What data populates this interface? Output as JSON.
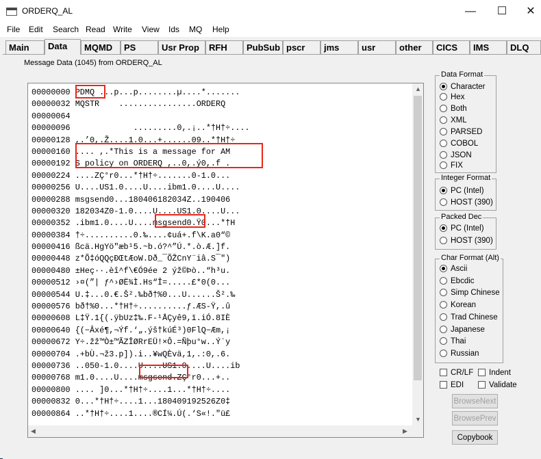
{
  "window": {
    "title": "ORDERQ_AL"
  },
  "menu": [
    "File",
    "Edit",
    "Search",
    "Read",
    "Write",
    "View",
    "Ids",
    "MQ",
    "Help"
  ],
  "tabs": [
    "Main",
    "Data",
    "MQMD",
    "PS",
    "Usr Prop",
    "RFH",
    "PubSub",
    "pscr",
    "jms",
    "usr",
    "other",
    "CICS",
    "IMS",
    "DLQ"
  ],
  "active_tab": "Data",
  "message_label": "Message Data (1045) from ORDERQ_AL",
  "data_lines": [
    "00000000 PDMQ ...p...p........µ....*.......",
    "00000032 MQSTR    ................ORDERQ",
    "00000064",
    "00000096             .........0,.¡..*†H†÷....",
    "00000128 ,.’0,.Ž....1.0...+......09..*†H†÷",
    "00000160 .... ,.*This is a message for AM",
    "00000192 S policy on ORDERQ ,..0,.ý0,.f .",
    "00000224 ....ZÇ°r0...*†H†÷.......0-1.0...",
    "00000256 U....US1.0....U....ibm1.0....U....",
    "00000288 msgsend0...180406182034Z..190406",
    "00000320 182034Z0-1.0....U....US1.0....U...",
    "00000352 .ibm1.0....U....msgsend0.Ÿ0...*†H",
    "00000384 †÷..........0.‰....¢uá+.f\\K.a0“©",
    "00000416 ßcä.HgYö\"æb¹5.~b.ó?^”Ú.*.ò.Æ.]f.",
    "00000448 z*Õ‡óQQçÐŒtÆoW.Dð_¯ÕŽCnY¨iâ.S¯\")",
    "00000480 ±Heç··.èî^f\\€Ó9ée 2 ýž©Þò..“h³u.",
    "00000512 ›¤(”| ƒ^›ØË¾Ì.Hs“Î=.....£*0(0...",
    "00000544 U.‡...0.€.Š².‰bð†%0...U......Š².‰",
    "00000576 bð†%0...*†H†÷..........ƒ.ÆS-Ÿ,.û",
    "00000608 L‡Ÿ.1{(.ÿbUz‡‰.F-¹ÅÇyê9,ï.iÓ.8IÈ",
    "00000640 {(−Âxé¶,¬Ýf.‘„.ýš†kúÉ³)0FlQ−Æm,¡",
    "00000672 Y÷.žž™Ò±™ÃZÎØRrEÜ!×Ô.=Ñþu°w..Ý`y",
    "00000704 .+bÙ.¬ž3.p]).i..¥wQÈvä,1,.:0,.6.",
    "00000736 ..050-1.0....U....US1.0....U....ib",
    "00000768 m1.0....U....msgsend.ZÇ°r0...+..",
    "00000800 .... ]0...*†H†÷....1...*†H†÷....",
    "00000832 0...*†H†÷....1...180409192526Z0‡",
    "00000864 ..*†H†÷....1....®CÍ¼.Ú(.‘S«!.\"ü£"
  ],
  "data_format": {
    "label": "Data Format",
    "options": [
      "Character",
      "Hex",
      "Both",
      "XML",
      "PARSED",
      "COBOL",
      "JSON",
      "FIX"
    ],
    "selected": "Character"
  },
  "integer_format": {
    "label": "Integer Format",
    "options": [
      "PC (Intel)",
      "HOST (390)"
    ],
    "selected": "PC (Intel)"
  },
  "packed_dec": {
    "label": "Packed Dec",
    "options": [
      "PC (Intel)",
      "HOST (390)"
    ],
    "selected": "PC (Intel)"
  },
  "char_format": {
    "label": "Char Format (Alt)",
    "options": [
      "Ascii",
      "Ebcdic",
      "Simp Chinese",
      "Korean",
      "Trad Chinese",
      "Japanese",
      "Thai",
      "Russian"
    ],
    "selected": "Ascii"
  },
  "checkboxes": [
    "CR/LF",
    "Indent",
    "EDI",
    "Validate"
  ],
  "buttons": {
    "browse_next": "BrowseNext",
    "browse_prev": "BrowsePrev",
    "copybook": "Copybook"
  },
  "colors": {
    "highlight": "#e8251a",
    "titlebar": "#ffffff",
    "window_bg": "#f0f0f0"
  }
}
